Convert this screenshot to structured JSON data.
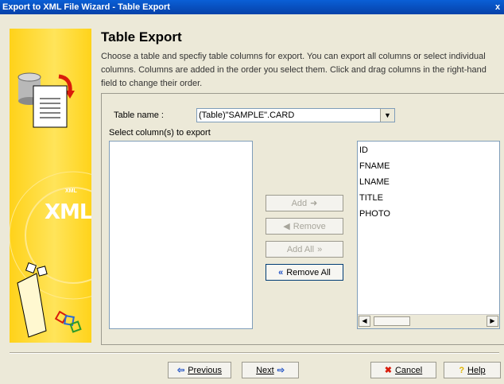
{
  "window": {
    "title": "Export to XML File Wizard - Table Export",
    "close_glyph": "x"
  },
  "banner": {
    "large_text": "XML",
    "small_text": "XML"
  },
  "page": {
    "heading": "Table Export",
    "description": "Choose a table and specfiy table columns for export. You can export all columns or select individual columns. Columns are added in the order you select them. Click and drag columns in the right-hand field to change their order."
  },
  "table_select": {
    "label": "Table name :",
    "value": "(Table)\"SAMPLE\".CARD"
  },
  "columns": {
    "select_label": "Select column(s) to export",
    "available": [],
    "selected": [
      "ID",
      "FNAME",
      "LNAME",
      "TITLE",
      "PHOTO"
    ]
  },
  "buttons": {
    "add": "Add",
    "remove": "Remove",
    "add_all": "Add All",
    "remove_all": "Remove All"
  },
  "footer": {
    "previous": "Previous",
    "next": "Next",
    "cancel": "Cancel",
    "help": "Help"
  }
}
